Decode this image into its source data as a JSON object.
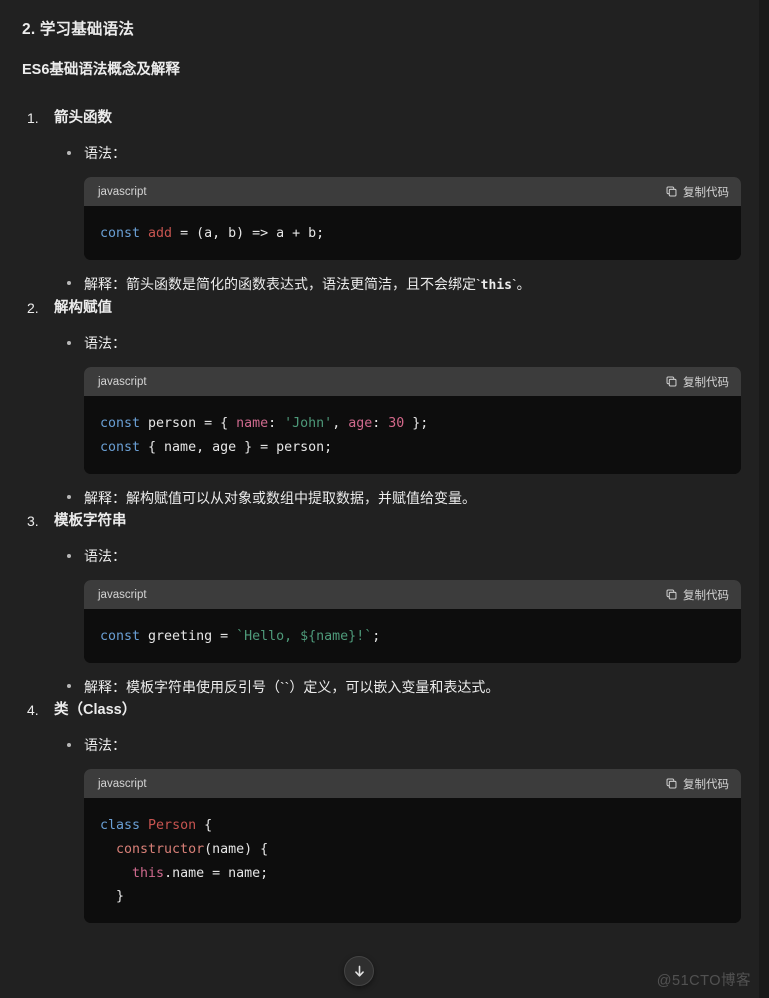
{
  "page": {
    "background_color": "#212121",
    "text_color": "#ececec"
  },
  "section": {
    "title": "2. 学习基础语法",
    "lead": "ES6基础语法概念及解释"
  },
  "labels": {
    "syntax": "语法：",
    "copy_code": "复制代码",
    "lang_javascript": "javascript"
  },
  "topics": [
    {
      "num": "1.",
      "title": "箭头函数",
      "syntax_label": "语法：",
      "code": {
        "lang": "javascript",
        "copy_label": "复制代码",
        "lines": [
          [
            {
              "t": "const",
              "c": "kw"
            },
            {
              "t": " ",
              "c": "plain"
            },
            {
              "t": "add",
              "c": "cls"
            },
            {
              "t": " = (a, b) => a + b;",
              "c": "plain"
            }
          ]
        ]
      },
      "explanation_prefix": "解释：箭头函数是简化的函数表达式，语法更简洁，且不会绑定`",
      "explanation_code": "this",
      "explanation_suffix": "`。"
    },
    {
      "num": "2.",
      "title": "解构赋值",
      "syntax_label": "语法：",
      "code": {
        "lang": "javascript",
        "copy_label": "复制代码",
        "lines": [
          [
            {
              "t": "const",
              "c": "kw"
            },
            {
              "t": " person = { ",
              "c": "plain"
            },
            {
              "t": "name",
              "c": "prop"
            },
            {
              "t": ": ",
              "c": "plain"
            },
            {
              "t": "'John'",
              "c": "str"
            },
            {
              "t": ", ",
              "c": "plain"
            },
            {
              "t": "age",
              "c": "prop"
            },
            {
              "t": ": ",
              "c": "plain"
            },
            {
              "t": "30",
              "c": "num"
            },
            {
              "t": " };",
              "c": "plain"
            }
          ],
          [
            {
              "t": "const",
              "c": "kw"
            },
            {
              "t": " { name, age } = person;",
              "c": "plain"
            }
          ]
        ]
      },
      "explanation_prefix": "解释：解构赋值可以从对象或数组中提取数据，并赋值给变量。",
      "explanation_code": "",
      "explanation_suffix": ""
    },
    {
      "num": "3.",
      "title": "模板字符串",
      "syntax_label": "语法：",
      "code": {
        "lang": "javascript",
        "copy_label": "复制代码",
        "lines": [
          [
            {
              "t": "const",
              "c": "kw"
            },
            {
              "t": " greeting = ",
              "c": "plain"
            },
            {
              "t": "`Hello, ${name}!`",
              "c": "str"
            },
            {
              "t": ";",
              "c": "plain"
            }
          ]
        ]
      },
      "explanation_prefix": "解释：模板字符串使用反引号（``）定义，可以嵌入变量和表达式。",
      "explanation_code": "",
      "explanation_suffix": ""
    },
    {
      "num": "4.",
      "title": "类（Class）",
      "syntax_label": "语法：",
      "code": {
        "lang": "javascript",
        "copy_label": "复制代码",
        "lines": [
          [
            {
              "t": "class",
              "c": "kw"
            },
            {
              "t": " ",
              "c": "plain"
            },
            {
              "t": "Person",
              "c": "cls"
            },
            {
              "t": " {",
              "c": "plain"
            }
          ],
          [
            {
              "t": "  ",
              "c": "plain"
            },
            {
              "t": "constructor",
              "c": "fn"
            },
            {
              "t": "(name) {",
              "c": "plain"
            }
          ],
          [
            {
              "t": "    ",
              "c": "plain"
            },
            {
              "t": "this",
              "c": "this"
            },
            {
              "t": ".name = name;",
              "c": "plain"
            }
          ],
          [
            {
              "t": "  }",
              "c": "plain"
            }
          ]
        ]
      },
      "explanation_prefix": "",
      "explanation_code": "",
      "explanation_suffix": ""
    }
  ],
  "scroll_button": {
    "icon": "arrow-down-icon"
  },
  "watermark": "@51CTO博客"
}
